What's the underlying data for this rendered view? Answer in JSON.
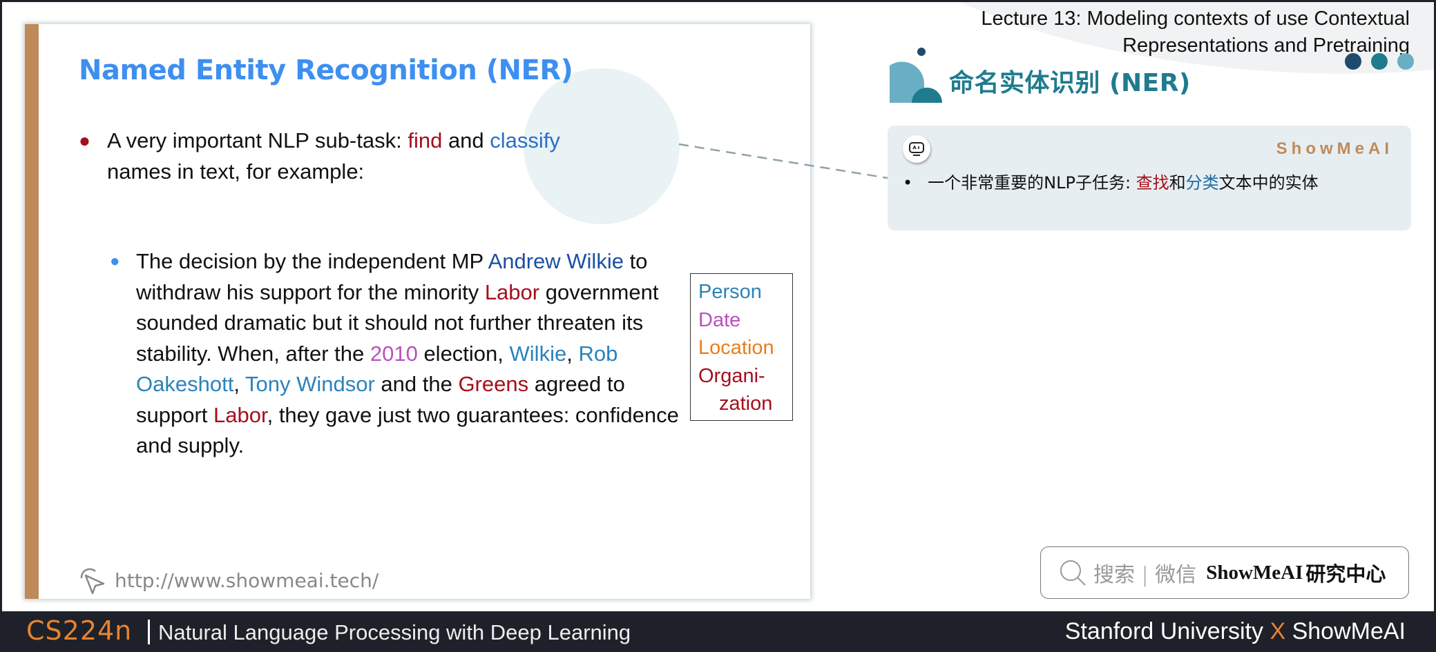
{
  "slide": {
    "title": "Named Entity Recognition (NER)",
    "bullet1": {
      "prefix": "A very important NLP sub-task: ",
      "find": "find",
      "and": " and ",
      "classify": "classify",
      "suffix": " names in text, for example:"
    },
    "example": {
      "t1": "The decision by the independent MP ",
      "e1": "Andrew Wilkie",
      "t2": " to withdraw his support for the minority ",
      "e2": "Labor",
      "t3": " government sounded dramatic but it should not further threaten its stability. When, after the ",
      "e3": "2010",
      "t4": " election, ",
      "e4": "Wilkie",
      "t5": ", ",
      "e5": "Rob Oakeshott",
      "t6": ", ",
      "e6": "Tony Windsor",
      "t7": " and the ",
      "e7": "Greens",
      "t8": " agreed to support ",
      "e8": "Labor",
      "t9": ", they gave just two guarantees: confidence and supply."
    },
    "legend": {
      "person": "Person",
      "date": "Date",
      "location": "Location",
      "organization_1": "Organi-",
      "organization_2": "zation"
    },
    "url": "http://www.showmeai.tech/"
  },
  "header": {
    "lecture_line1": "Lecture 13:  Modeling contexts of use Contextual",
    "lecture_line2": "Representations and Pretraining",
    "cn_heading": "命名实体识别 (NER)"
  },
  "card": {
    "brand": "ShowMeAI",
    "bullet": "•",
    "text_prefix": "一个非常重要的NLP子任务: ",
    "find": "查找",
    "and": "和",
    "classify": "分类",
    "suffix": "文本中的实体"
  },
  "search": {
    "hint": "搜索 | 微信",
    "brand": "ShowMeAI",
    "brand_cn": "研究中心"
  },
  "footer": {
    "course_code": "CS224n",
    "course_name": "Natural Language Processing with Deep Learning",
    "partner_left": "Stanford University ",
    "partner_x": "X",
    "partner_right": " ShowMeAI"
  },
  "colors": {
    "title_blue": "#3d8ff0",
    "accent_tan": "#bf8a58",
    "person": "#2b82ba",
    "date": "#bb4fbf",
    "location": "#ea7d1c",
    "organization": "#a50f1b",
    "heading_teal": "#1f7b8e",
    "footer_orange": "#e8832f"
  }
}
